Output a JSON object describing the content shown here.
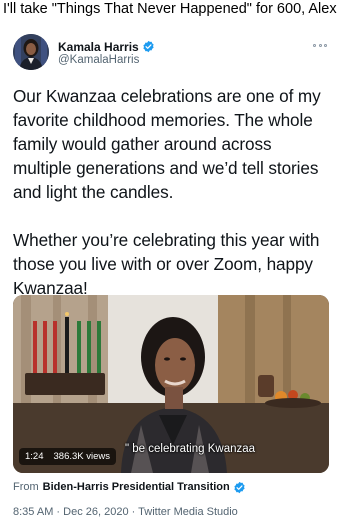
{
  "caption": "I'll take \"Things That Never Happened\" for 600, Alex",
  "tweet": {
    "author_name": "Kamala Harris",
    "author_handle": "@KamalaHarris",
    "text": "Our Kwanzaa celebrations are one of my favorite childhood memories. The whole family would gather around across multiple generations and we’d tell stories and light the candles.\n\nWhether you’re celebrating this year with those you live with or over Zoom, happy Kwanzaa!",
    "video": {
      "subtitle": "\" be celebrating Kwanzaa",
      "duration": "1:24",
      "views": "386.3K views"
    },
    "source_prefix": "From",
    "source_name": "Biden-Harris Presidential Transition",
    "meta": "8:35 AM · Dec 26, 2020 · Twitter Media Studio"
  },
  "colors": {
    "verified_blue": "#1d9bf0",
    "text_primary": "#0f1419",
    "text_secondary": "#536471"
  },
  "icons": [
    "verified-badge-icon",
    "more-options-icon"
  ]
}
